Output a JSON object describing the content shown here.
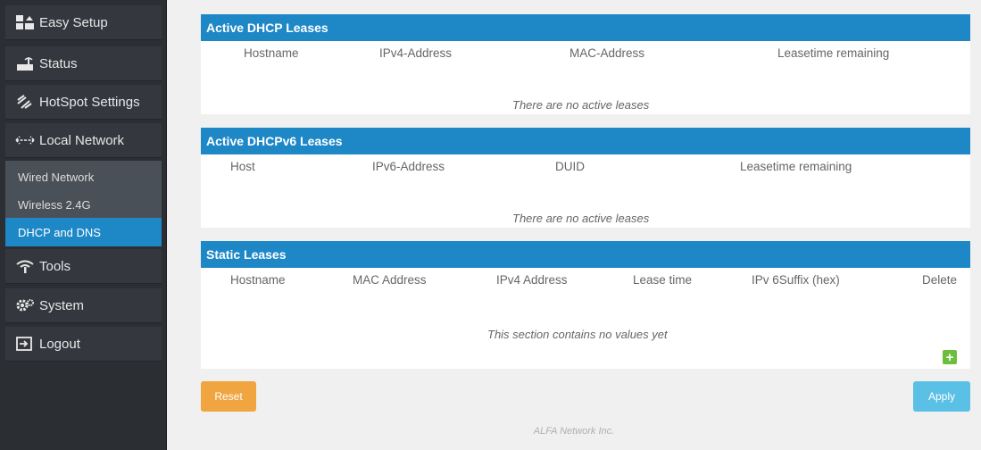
{
  "sidebar": {
    "items": [
      {
        "label": "Easy Setup",
        "icon": "easy-setup-icon"
      },
      {
        "label": "Status",
        "icon": "status-icon"
      },
      {
        "label": "HotSpot Settings",
        "icon": "hotspot-icon"
      },
      {
        "label": "Local Network",
        "icon": "local-network-icon"
      },
      {
        "label": "Tools",
        "icon": "tools-icon"
      },
      {
        "label": "System",
        "icon": "system-icon"
      },
      {
        "label": "Logout",
        "icon": "logout-icon"
      }
    ],
    "subitems": [
      {
        "label": "Wired Network"
      },
      {
        "label": "Wireless 2.4G"
      },
      {
        "label": "DHCP and DNS",
        "active": true
      }
    ]
  },
  "dhcp": {
    "title": "Active DHCP Leases",
    "columns": [
      "Hostname",
      "IPv4-Address",
      "MAC-Address",
      "Leasetime remaining"
    ],
    "empty": "There are no active leases"
  },
  "dhcpv6": {
    "title": "Active DHCPv6 Leases",
    "columns": [
      "Host",
      "IPv6-Address",
      "DUID",
      "Leasetime remaining"
    ],
    "empty": "There are no active leases"
  },
  "static": {
    "title": "Static Leases",
    "columns": [
      "Hostname",
      "MAC Address",
      "IPv4 Address",
      "Lease time",
      "IPv 6Suffix (hex)",
      "Delete"
    ],
    "empty": "This section contains no values yet",
    "add_symbol": "+"
  },
  "buttons": {
    "reset": "Reset",
    "apply": "Apply"
  },
  "footer": "ALFA Network Inc.",
  "colors": {
    "accent": "#1e88c7",
    "reset": "#f0a540",
    "apply": "#5bc0e6",
    "add": "#6cbf3c"
  }
}
